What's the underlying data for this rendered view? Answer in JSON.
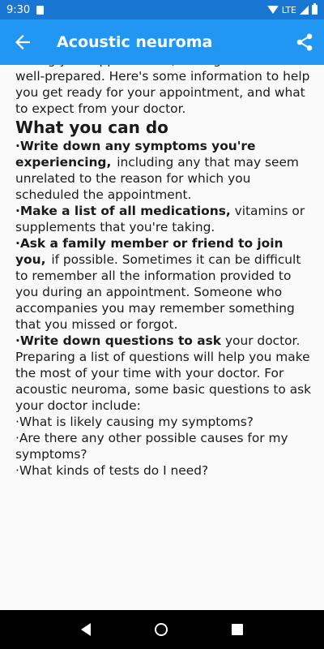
{
  "status": {
    "time": "9:30",
    "network": "LTE"
  },
  "app_bar": {
    "title": "Acoustic neuroma"
  },
  "content": {
    "intro": "during your appointment, it's a good idea to be well-prepared. Here's some information to help you get ready for your appointment, and what to expect from your doctor.",
    "heading": "What you can do",
    "bullets": [
      {
        "bold": "·Write down any symptoms you're experiencing,",
        "rest": "including any that may seem unrelated to the reason for which you scheduled the appointment."
      },
      {
        "bold": "·Make a list of all medications,",
        "rest": "vitamins or supplements that you're taking."
      },
      {
        "bold": "·Ask a family member or friend to join you,",
        "rest": "if possible. Sometimes it can be difficult to remember all the information provided to you during an appointment. Someone who accompanies you may remember something that you missed or forgot."
      },
      {
        "bold": "·Write down questions to ask",
        "rest": "your doctor."
      }
    ],
    "paragraph": "Preparing a list of questions will help you make the most of your time with your doctor. For acoustic neuroma, some basic questions to ask your doctor include:",
    "questions": [
      "·What is likely causing my symptoms?",
      "·Are there any other possible causes for my symptoms?",
      "·What kinds of tests do I need?"
    ]
  },
  "icons": {
    "back": "arrow-back-icon",
    "share": "share-icon",
    "nav_back": "triangle-back-icon",
    "nav_home": "circle-home-icon",
    "nav_recents": "square-recents-icon"
  },
  "colors": {
    "status_bar": "#1976d2",
    "app_bar": "#2196f3",
    "nav_bar": "#000000",
    "background": "#fafafa"
  }
}
